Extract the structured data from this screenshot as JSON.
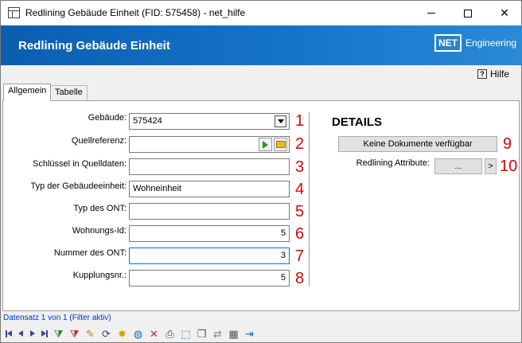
{
  "window": {
    "title": "Redlining Gebäude Einheit (FID: 575458) - net_hilfe"
  },
  "banner": {
    "title": "Redlining Gebäude Einheit",
    "brand_net": "NET",
    "brand_text": "Engineering"
  },
  "help": {
    "icon_text": "?",
    "label": "Hilfe"
  },
  "tabs": [
    {
      "label": "Allgemein",
      "active": true
    },
    {
      "label": "Tabelle",
      "active": false
    }
  ],
  "form": {
    "fields": [
      {
        "label": "Gebäude:",
        "value": "575424",
        "marker": "1"
      },
      {
        "label": "Quellreferenz:",
        "value": "",
        "marker": "2"
      },
      {
        "label": "Schlüssel in Quelldaten:",
        "value": "",
        "marker": "3"
      },
      {
        "label": "Typ der Gebäudeeinheit:",
        "value": "Wohneinheit",
        "marker": "4"
      },
      {
        "label": "Typ des ONT:",
        "value": "",
        "marker": "5"
      },
      {
        "label": "Wohnungs-Id:",
        "value": "5",
        "marker": "6"
      },
      {
        "label": "Nummer des ONT:",
        "value": "3",
        "marker": "7"
      },
      {
        "label": "Kupplungsnr.:",
        "value": "5",
        "marker": "8"
      }
    ]
  },
  "details": {
    "title": "DETAILS",
    "documents_button": "Keine Dokumente verfügbar",
    "documents_marker": "9",
    "redlining_label": "Redlining Attribute:",
    "redlining_button": "...",
    "redlining_nav": ">",
    "redlining_marker": "10"
  },
  "status": {
    "record_info": "Datensatz 1 von 1 (Filter aktiv)"
  },
  "toolbar_icons": [
    "first-record-icon",
    "previous-record-icon",
    "next-record-icon",
    "last-record-icon",
    "add-filter-icon",
    "remove-filter-icon",
    "edit-icon",
    "refresh-icon",
    "new-icon",
    "globe-icon",
    "delete-icon",
    "print-icon",
    "select-icon",
    "copy-icon",
    "move-icon",
    "table-icon",
    "exit-icon"
  ],
  "colors": {
    "banner": "#1574c8",
    "marker_red": "#e00000",
    "link_blue": "#0037c8",
    "focus_blue": "#0078d7"
  }
}
